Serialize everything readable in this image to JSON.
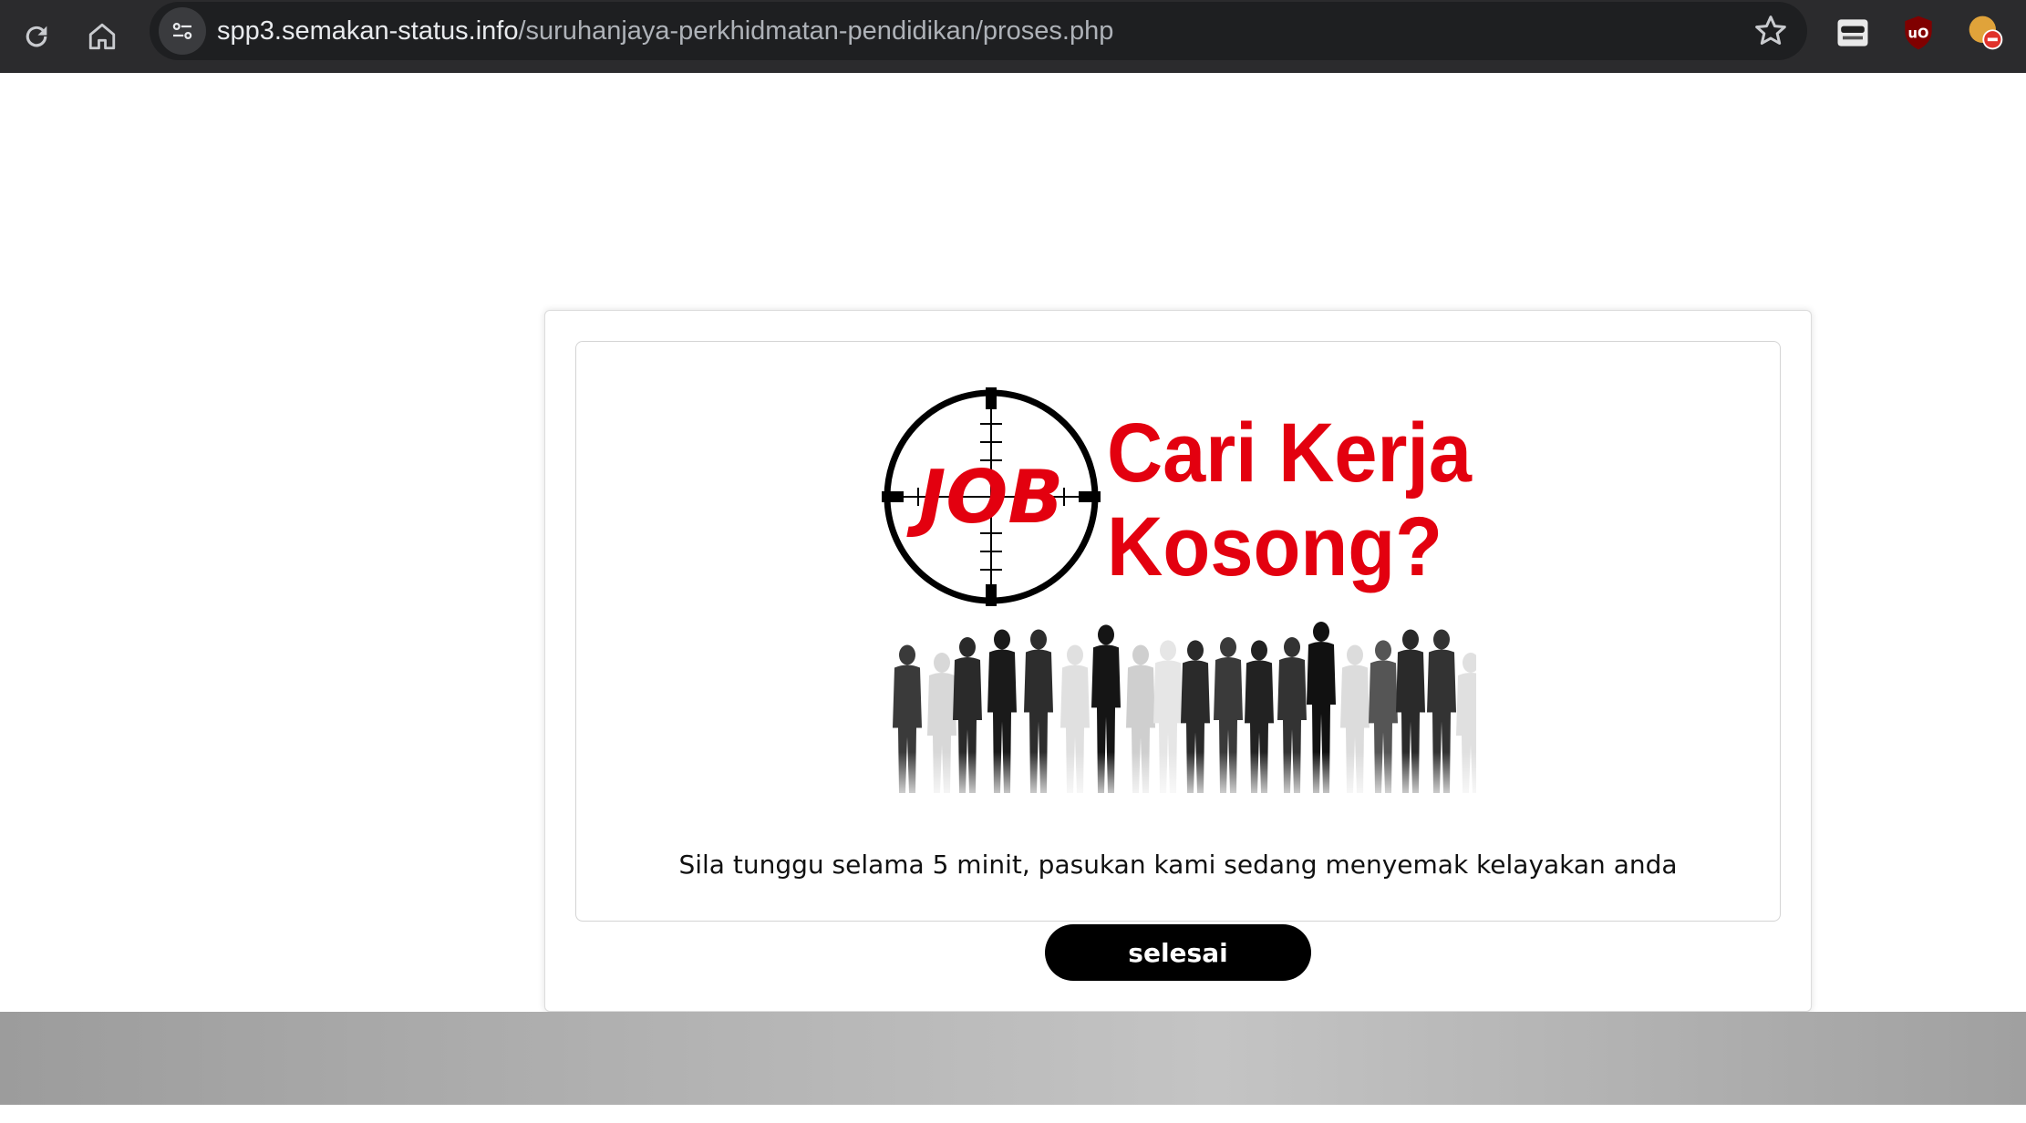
{
  "browser": {
    "url_host": "spp3.semakan-status.info",
    "url_path": "/suruhanjaya-perkhidmatan-pendidikan/proses.php",
    "icons": [
      "reload-icon",
      "home-icon",
      "site-info-icon",
      "bookmark-star-icon",
      "incognito-extension-icon",
      "ublock-origin-icon",
      "extension-blocked-icon"
    ]
  },
  "graphic": {
    "headline_line1": "Cari Kerja",
    "headline_line2": "Kosong?",
    "target_word": "JOB",
    "accent_color": "#e3000f"
  },
  "content": {
    "message": "Sila tunggu selama 5 minit, pasukan kami sedang menyemak kelayakan anda",
    "button_label": "selesai"
  },
  "colors": {
    "toolbar": "#2b2b2d",
    "button": "#000000",
    "footer": "#b5b5b5"
  }
}
